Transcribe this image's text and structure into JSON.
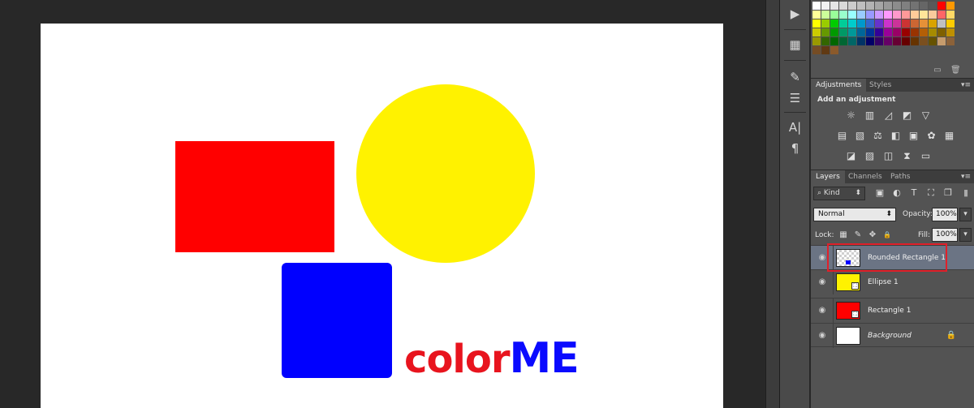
{
  "canvas": {
    "shapes": [
      {
        "id": "rect-red",
        "color": "#ff0000"
      },
      {
        "id": "ellipse-yellow",
        "color": "#fff200"
      },
      {
        "id": "rrect-blue",
        "color": "#0000ff"
      }
    ],
    "logo": {
      "part1": "color",
      "part2": "ME",
      "color1": "#e8141e",
      "color2": "#0a0aff"
    }
  },
  "tools": [
    {
      "icon": "play-icon",
      "glyph": "▶"
    },
    {
      "icon": "swatch-grid-icon",
      "glyph": "▦"
    },
    {
      "icon": "brush-tool-icon",
      "glyph": "✎"
    },
    {
      "icon": "sliders-icon",
      "glyph": "☰"
    },
    {
      "icon": "character-icon",
      "glyph": "A|"
    },
    {
      "icon": "paragraph-icon",
      "glyph": "¶"
    }
  ],
  "swatches": {
    "rows": [
      [
        "#ffffff",
        "#f2f2f2",
        "#e5e5e5",
        "#d9d9d9",
        "#cccccc",
        "#bfbfbf",
        "#b3b3b3",
        "#a6a6a6",
        "#999999",
        "#8c8c8c",
        "#808080",
        "#737373",
        "#666666",
        "#595959",
        "#ff0000",
        "#ff9900"
      ],
      [
        "#ffff99",
        "#ccff99",
        "#99ff99",
        "#99ffcc",
        "#99ffff",
        "#99ccff",
        "#9999ff",
        "#cc99ff",
        "#ff99ff",
        "#ff99cc",
        "#ff9999",
        "#ffcc99",
        "#ffe599",
        "#f9cb9c",
        "#ff6666",
        "#ffd966"
      ],
      [
        "#ffff00",
        "#99cc00",
        "#00cc00",
        "#00cc99",
        "#00cccc",
        "#0099cc",
        "#3366cc",
        "#6633cc",
        "#cc33cc",
        "#cc3399",
        "#cc3333",
        "#cc6633",
        "#e69138",
        "#d9a300",
        "#c0c0c0",
        "#ffcc00"
      ],
      [
        "#cccc00",
        "#669900",
        "#009900",
        "#009966",
        "#009999",
        "#006699",
        "#003399",
        "#330099",
        "#990099",
        "#990066",
        "#990000",
        "#993300",
        "#b45f06",
        "#a68b00",
        "#7f6000",
        "#bf9000"
      ],
      [
        "#999900",
        "#336600",
        "#006600",
        "#006633",
        "#006666",
        "#003366",
        "#000066",
        "#330066",
        "#660066",
        "#660033",
        "#660000",
        "#663300",
        "#7a4f1f",
        "#665200",
        "#c69c6d",
        "#8c6239"
      ],
      [
        "#754c24",
        "#603913",
        "#8b5a2b"
      ]
    ],
    "footer_icons": [
      "new-swatch-icon",
      "trash-icon"
    ]
  },
  "adjustments": {
    "tabs": [
      {
        "label": "Adjustments",
        "active": true
      },
      {
        "label": "Styles",
        "active": false
      }
    ],
    "title": "Add an adjustment",
    "rows": [
      [
        {
          "icon": "brightness-contrast-icon",
          "glyph": "☼"
        },
        {
          "icon": "levels-icon",
          "glyph": "▥"
        },
        {
          "icon": "curves-icon",
          "glyph": "◿"
        },
        {
          "icon": "exposure-icon",
          "glyph": "◩"
        },
        {
          "icon": "gradient-triangle-icon",
          "glyph": "▽"
        }
      ],
      [
        {
          "icon": "vibrance-icon",
          "glyph": "▤"
        },
        {
          "icon": "hue-saturation-icon",
          "glyph": "▧"
        },
        {
          "icon": "color-balance-icon",
          "glyph": "⚖"
        },
        {
          "icon": "black-white-icon",
          "glyph": "◧"
        },
        {
          "icon": "photo-filter-icon",
          "glyph": "▣"
        },
        {
          "icon": "channel-mixer-icon",
          "glyph": "✿"
        },
        {
          "icon": "color-lookup-icon",
          "glyph": "▦"
        }
      ],
      [
        {
          "icon": "invert-icon",
          "glyph": "◪"
        },
        {
          "icon": "posterize-icon",
          "glyph": "▨"
        },
        {
          "icon": "threshold-icon",
          "glyph": "◫"
        },
        {
          "icon": "selective-color-icon",
          "glyph": "⧗"
        },
        {
          "icon": "gradient-map-icon",
          "glyph": "▭"
        }
      ]
    ]
  },
  "layers": {
    "tabs": [
      {
        "label": "Layers",
        "active": true
      },
      {
        "label": "Channels",
        "active": false
      },
      {
        "label": "Paths",
        "active": false
      }
    ],
    "filter_label": "Kind",
    "filter_icons": [
      {
        "icon": "pixel-filter-icon",
        "glyph": "▣"
      },
      {
        "icon": "adjustment-filter-icon",
        "glyph": "◐"
      },
      {
        "icon": "type-filter-icon",
        "glyph": "T"
      },
      {
        "icon": "shape-filter-icon",
        "glyph": "⛶"
      },
      {
        "icon": "smart-object-filter-icon",
        "glyph": "❐"
      }
    ],
    "blend_mode": "Normal",
    "opacity_label": "Opacity:",
    "opacity_value": "100%",
    "lock_label": "Lock:",
    "lock_icons": [
      {
        "icon": "lock-transparent-icon",
        "glyph": "▦"
      },
      {
        "icon": "lock-image-icon",
        "glyph": "✎"
      },
      {
        "icon": "lock-position-icon",
        "glyph": "✥"
      },
      {
        "icon": "lock-all-icon",
        "glyph": "🔒"
      }
    ],
    "fill_label": "Fill:",
    "fill_value": "100%",
    "items": [
      {
        "name": "Rounded Rectangle 1",
        "selected": true
      },
      {
        "name": "Ellipse 1",
        "selected": false,
        "thumb_color": "#fff200"
      },
      {
        "name": "Rectangle 1",
        "selected": false,
        "thumb_color": "#ff0000"
      },
      {
        "name": "Background",
        "selected": false
      }
    ]
  }
}
